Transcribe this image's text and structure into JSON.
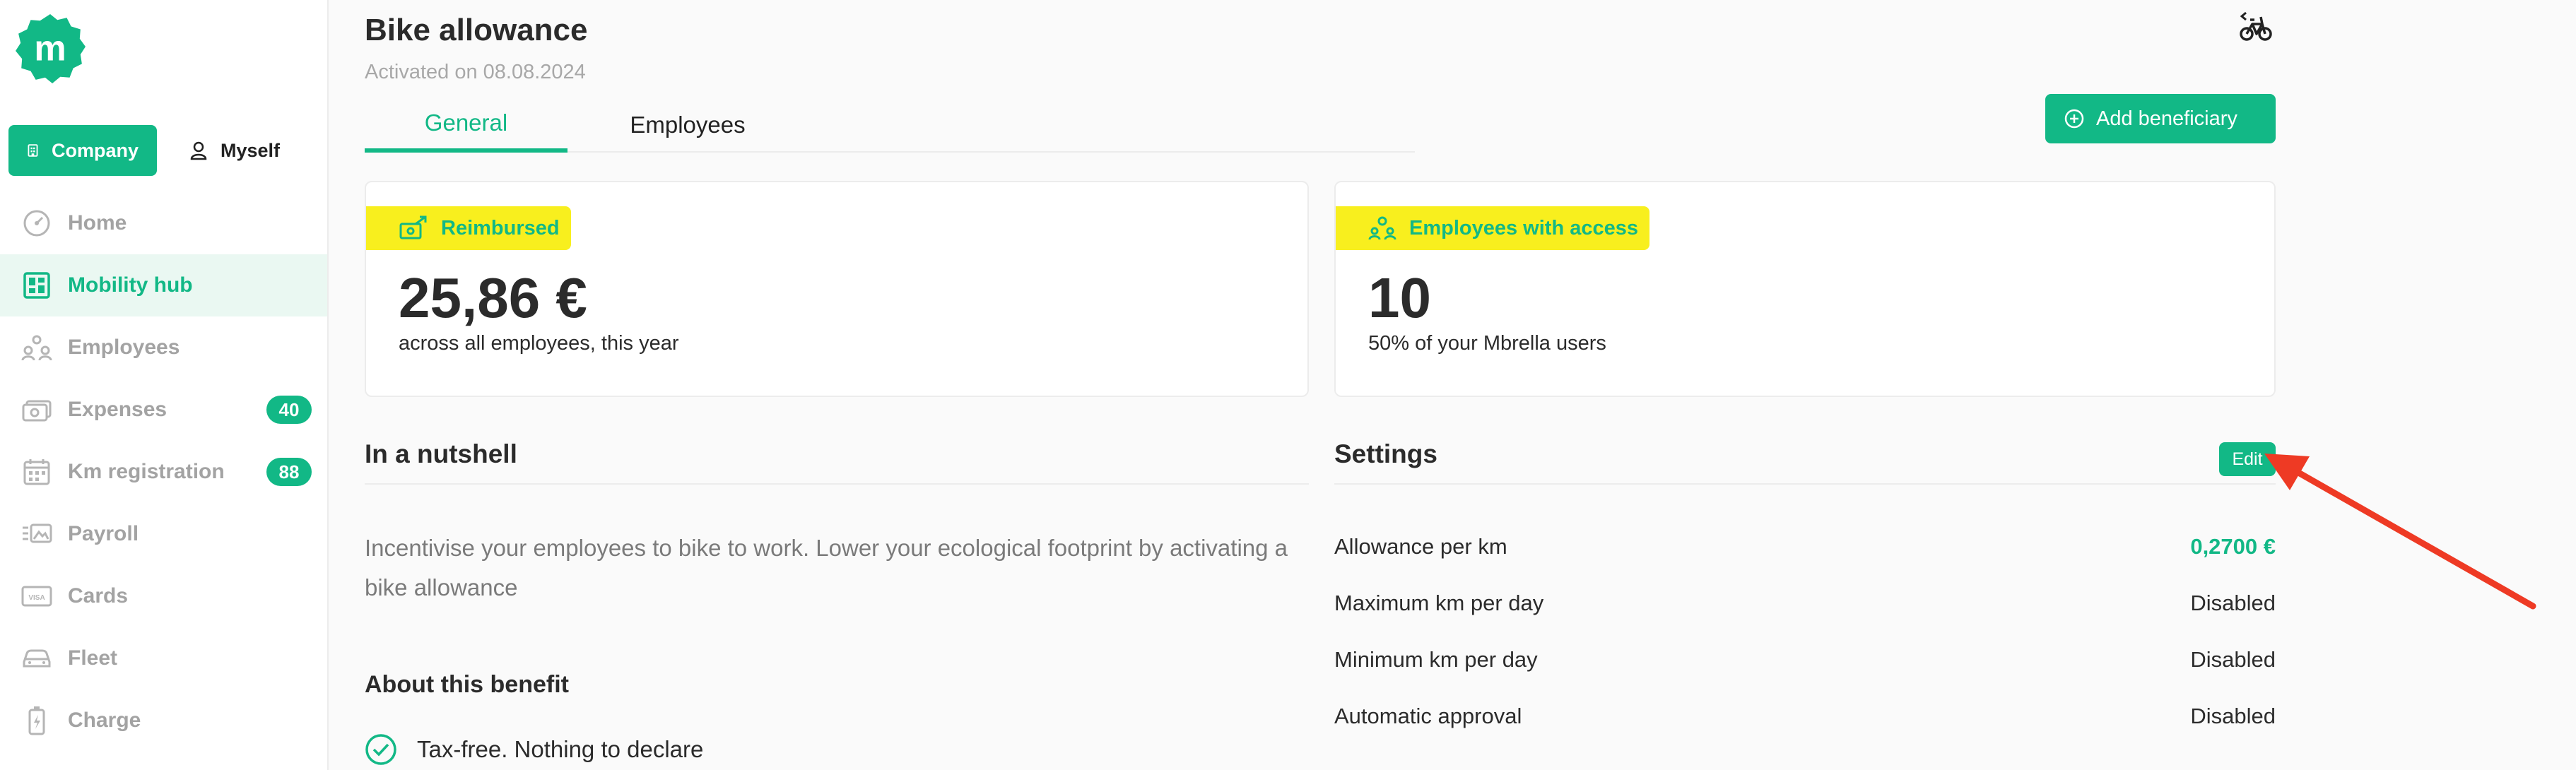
{
  "colors": {
    "accent": "#12b886",
    "highlight": "#f8ef1e",
    "arrow": "#ee3a24"
  },
  "brand": {
    "logo_letter": "m"
  },
  "toggle": {
    "company": "Company",
    "myself": "Myself"
  },
  "sidebar": {
    "items": [
      {
        "label": "Home",
        "icon": "gauge-icon"
      },
      {
        "label": "Mobility hub",
        "icon": "grid-icon",
        "active": true
      },
      {
        "label": "Employees",
        "icon": "people-icon"
      },
      {
        "label": "Expenses",
        "icon": "cash-icon",
        "badge": "40"
      },
      {
        "label": "Km registration",
        "icon": "calendar-icon",
        "badge": "88"
      },
      {
        "label": "Payroll",
        "icon": "payroll-icon"
      },
      {
        "label": "Cards",
        "icon": "card-icon"
      },
      {
        "label": "Fleet",
        "icon": "car-icon"
      },
      {
        "label": "Charge",
        "icon": "battery-icon"
      }
    ]
  },
  "header": {
    "title": "Bike allowance",
    "subtitle": "Activated on 08.08.2024"
  },
  "tabs": [
    {
      "label": "General",
      "active": true
    },
    {
      "label": "Employees",
      "active": false
    }
  ],
  "add_button": {
    "label": "Add beneficiary"
  },
  "cards": [
    {
      "chip": "Reimbursed",
      "value": "25,86 €",
      "caption": "across all employees, this year"
    },
    {
      "chip": "Employees with access",
      "value": "10",
      "caption": "50% of your Mbrella users"
    }
  ],
  "nutshell": {
    "title": "In a nutshell",
    "text": "Incentivise your employees to bike to work. Lower your ecological footprint by activating a bike allowance",
    "about_title": "About this benefit",
    "checks": [
      "Tax-free. Nothing to declare"
    ]
  },
  "settings": {
    "title": "Settings",
    "edit_label": "Edit",
    "rows": [
      {
        "label": "Allowance per km",
        "value": "0,2700 €",
        "accent": true
      },
      {
        "label": "Maximum km per day",
        "value": "Disabled"
      },
      {
        "label": "Minimum km per day",
        "value": "Disabled"
      },
      {
        "label": "Automatic approval",
        "value": "Disabled"
      }
    ]
  }
}
